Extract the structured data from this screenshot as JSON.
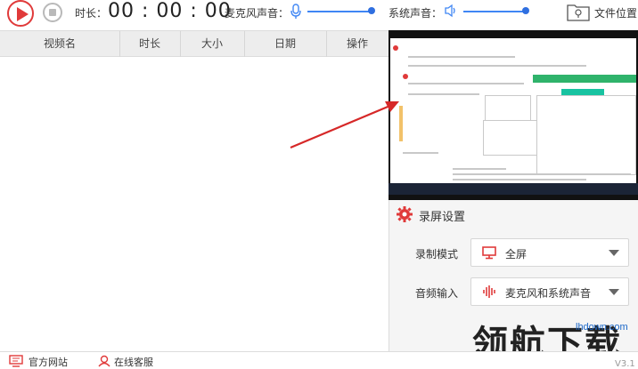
{
  "toolbar": {
    "duration_label": "时长：",
    "duration_value": "00 : 00 : 00",
    "mic_label": "麦克风声音：",
    "system_label": "系统声音：",
    "file_location_label": "文件位置"
  },
  "table": {
    "headers": [
      "视频名",
      "时长",
      "大小",
      "日期",
      "操作"
    ],
    "rows": []
  },
  "settings": {
    "title": "录屏设置",
    "record_mode_label": "录制模式",
    "record_mode_value": "全屏",
    "audio_input_label": "音频输入",
    "audio_input_value": "麦克风和系统声音"
  },
  "watermark": {
    "text": "领航下载",
    "url": "lhdown.com"
  },
  "footer": {
    "website_label": "官方网站",
    "service_label": "在线客服",
    "version": "V3.1"
  },
  "colors": {
    "accent_red": "#e03a3a",
    "accent_blue": "#3f86f4"
  },
  "sliders": {
    "mic_level": 1.0,
    "system_level": 1.0
  }
}
